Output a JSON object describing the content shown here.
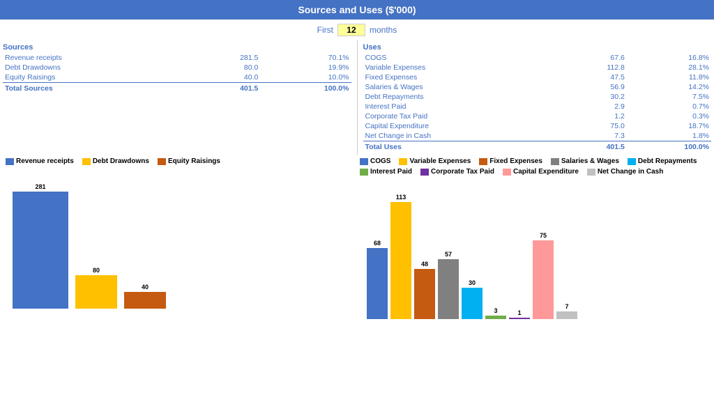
{
  "header": {
    "title": "Sources and Uses ($'000)"
  },
  "months_row": {
    "first_label": "First",
    "months_value": "12",
    "months_label": "months"
  },
  "sources": {
    "section_title": "Sources",
    "items": [
      {
        "label": "Revenue receipts",
        "value": "281.5",
        "pct": "70.1%"
      },
      {
        "label": "Debt Drawdowns",
        "value": "80.0",
        "pct": "19.9%"
      },
      {
        "label": "Equity Raisings",
        "value": "40.0",
        "pct": "10.0%"
      }
    ],
    "total_label": "Total Sources",
    "total_value": "401.5",
    "total_pct": "100.0%"
  },
  "uses": {
    "section_title": "Uses",
    "items": [
      {
        "label": "COGS",
        "value": "67.6",
        "pct": "16.8%"
      },
      {
        "label": "Variable Expenses",
        "value": "112.8",
        "pct": "28.1%"
      },
      {
        "label": "Fixed Expenses",
        "value": "47.5",
        "pct": "11.8%"
      },
      {
        "label": "Salaries & Wages",
        "value": "56.9",
        "pct": "14.2%"
      },
      {
        "label": "Debt Repayments",
        "value": "30.2",
        "pct": "7.5%"
      },
      {
        "label": "Interest Paid",
        "value": "2.9",
        "pct": "0.7%"
      },
      {
        "label": "Corporate Tax Paid",
        "value": "1.2",
        "pct": "0.3%"
      },
      {
        "label": "Capital Expenditure",
        "value": "75.0",
        "pct": "18.7%"
      },
      {
        "label": "Net Change in Cash",
        "value": "7.3",
        "pct": "1.8%"
      }
    ],
    "total_label": "Total Uses",
    "total_value": "401.5",
    "total_pct": "100.0%"
  },
  "sources_chart": {
    "legend": [
      {
        "label": "Revenue receipts",
        "color": "#4472C4"
      },
      {
        "label": "Debt Drawdowns",
        "color": "#FFC000"
      },
      {
        "label": "Equity Raisings",
        "color": "#C55A11"
      }
    ],
    "bars": [
      {
        "label": "281",
        "value": 281,
        "color": "#4472C4",
        "width": 80
      },
      {
        "label": "80",
        "value": 80,
        "color": "#FFC000",
        "width": 60
      },
      {
        "label": "40",
        "value": 40,
        "color": "#C55A11",
        "width": 60
      }
    ],
    "max_value": 300
  },
  "uses_chart": {
    "legend": [
      {
        "label": "COGS",
        "color": "#4472C4"
      },
      {
        "label": "Variable Expenses",
        "color": "#FFC000"
      },
      {
        "label": "Fixed Expenses",
        "color": "#C55A11"
      },
      {
        "label": "Salaries & Wages",
        "color": "#808080"
      },
      {
        "label": "Debt Repayments",
        "color": "#00B0F0"
      },
      {
        "label": "Interest Paid",
        "color": "#70AD47"
      },
      {
        "label": "Corporate Tax Paid",
        "color": "#7030A0"
      },
      {
        "label": "Capital Expenditure",
        "color": "#FF9999"
      },
      {
        "label": "Net Change in Cash",
        "color": "#C0C0C0"
      }
    ],
    "bars": [
      {
        "label": "68",
        "value": 68,
        "color": "#4472C4",
        "width": 30
      },
      {
        "label": "113",
        "value": 113,
        "color": "#FFC000",
        "width": 30
      },
      {
        "label": "48",
        "value": 48,
        "color": "#C55A11",
        "width": 30
      },
      {
        "label": "57",
        "value": 57,
        "color": "#808080",
        "width": 30
      },
      {
        "label": "30",
        "value": 30,
        "color": "#00B0F0",
        "width": 30
      },
      {
        "label": "3",
        "value": 3,
        "color": "#70AD47",
        "width": 30
      },
      {
        "label": "1",
        "value": 1,
        "color": "#7030A0",
        "width": 30
      },
      {
        "label": "75",
        "value": 75,
        "color": "#FF9999",
        "width": 30
      },
      {
        "label": "7",
        "value": 7,
        "color": "#C0C0C0",
        "width": 30
      }
    ],
    "max_value": 120
  }
}
